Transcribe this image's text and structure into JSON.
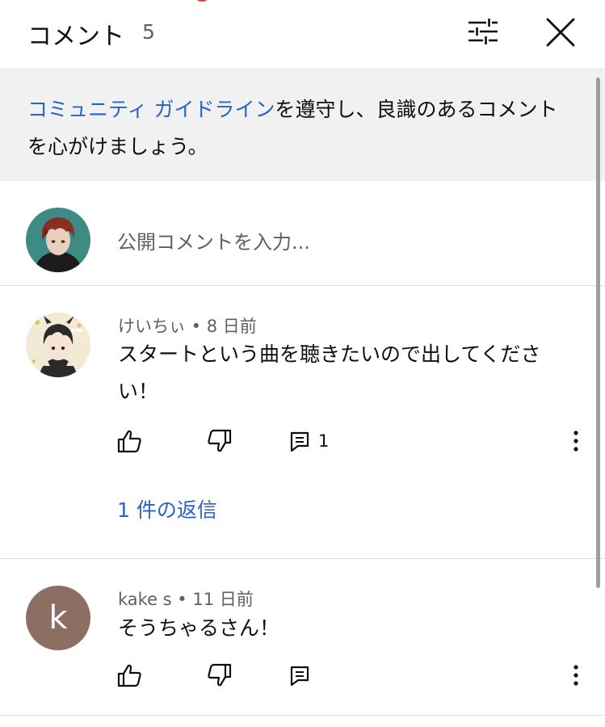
{
  "header": {
    "title": "コメント",
    "count": "5",
    "icons": {
      "filter": "sliders-icon",
      "close": "close-icon"
    }
  },
  "guidelines": {
    "link_text": "コミュニティ ガイドライン",
    "rest_text": "を遵守し、良識のあるコメントを心がけましょう。"
  },
  "comment_input": {
    "placeholder": "公開コメントを入力..."
  },
  "comments": [
    {
      "author": "けいちぃ",
      "time": "8 日前",
      "text": "スタートという曲を聴きたいので出してください！",
      "reply_count": "1",
      "replies_link": "1 件の返信",
      "avatar": "illustrated-character-avatar"
    },
    {
      "author": "kake s",
      "time": "11 日前",
      "text": "そうちゃるさん！",
      "avatar_letter": "k",
      "avatar_color": "#8d6e63"
    }
  ],
  "colors": {
    "link": "#2764c5",
    "secondary_text": "#606060",
    "banner_bg": "#f1f1f1"
  }
}
